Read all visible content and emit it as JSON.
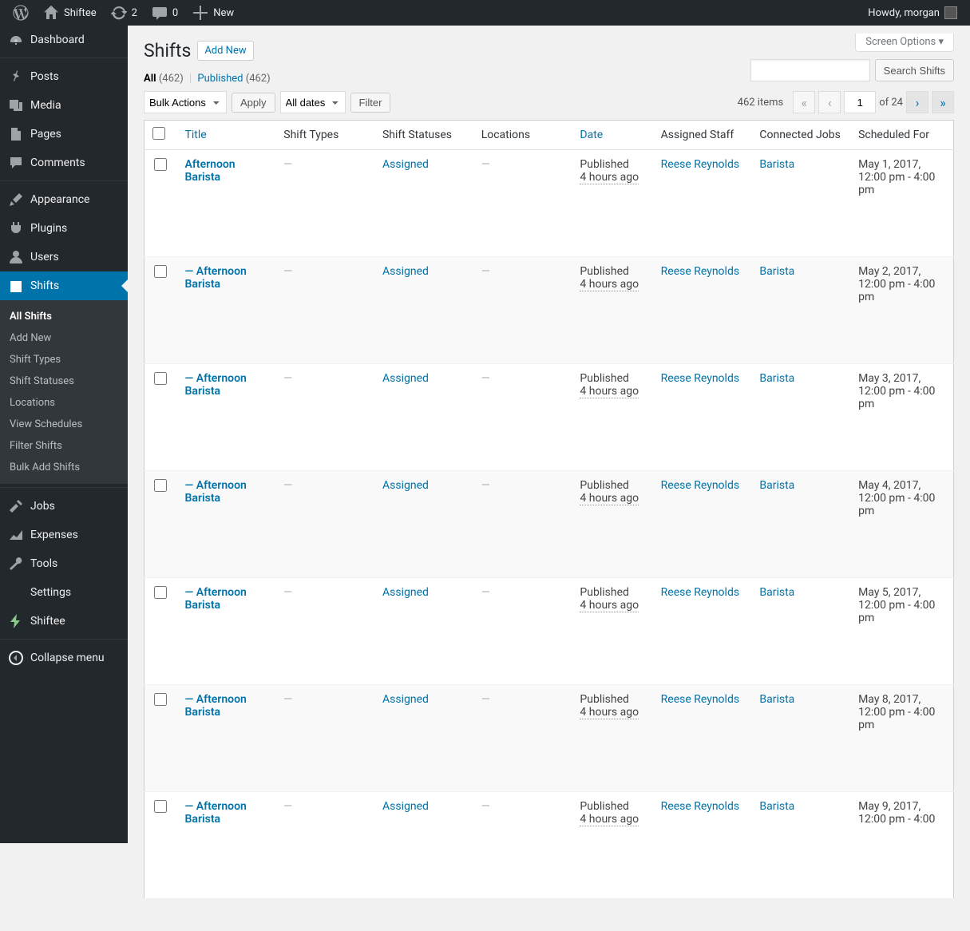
{
  "adminbar": {
    "site_name": "Shiftee",
    "updates_count": "2",
    "comments_count": "0",
    "new_label": "New",
    "greeting": "Howdy, morgan"
  },
  "sidebar": {
    "items": [
      {
        "label": "Dashboard",
        "icon": "dashboard"
      },
      {
        "label": "Posts",
        "icon": "pin"
      },
      {
        "label": "Media",
        "icon": "media"
      },
      {
        "label": "Pages",
        "icon": "page"
      },
      {
        "label": "Comments",
        "icon": "comment"
      },
      {
        "label": "Appearance",
        "icon": "brush"
      },
      {
        "label": "Plugins",
        "icon": "plugin"
      },
      {
        "label": "Users",
        "icon": "user"
      },
      {
        "label": "Shifts",
        "icon": "calendar",
        "current": true
      },
      {
        "label": "Jobs",
        "icon": "hammer"
      },
      {
        "label": "Expenses",
        "icon": "chart"
      },
      {
        "label": "Tools",
        "icon": "wrench"
      },
      {
        "label": "Settings",
        "icon": "settings"
      },
      {
        "label": "Shiftee",
        "icon": "bolt"
      },
      {
        "label": "Collapse menu",
        "icon": "collapse"
      }
    ],
    "submenu": [
      {
        "label": "All Shifts",
        "current": true
      },
      {
        "label": "Add New"
      },
      {
        "label": "Shift Types"
      },
      {
        "label": "Shift Statuses"
      },
      {
        "label": "Locations"
      },
      {
        "label": "View Schedules"
      },
      {
        "label": "Filter Shifts"
      },
      {
        "label": "Bulk Add Shifts"
      }
    ]
  },
  "page": {
    "title": "Shifts",
    "add_new": "Add New",
    "screen_options": "Screen Options",
    "filters": {
      "all_label": "All",
      "all_count": "(462)",
      "published_label": "Published",
      "published_count": "(462)"
    },
    "search_button": "Search Shifts",
    "bulk_actions": "Bulk Actions",
    "apply": "Apply",
    "all_dates": "All dates",
    "filter": "Filter",
    "pagination": {
      "items": "462 items",
      "current": "1",
      "of": "of 24"
    },
    "columns": {
      "title": "Title",
      "types": "Shift Types",
      "statuses": "Shift Statuses",
      "locations": "Locations",
      "date": "Date",
      "staff": "Assigned Staff",
      "jobs": "Connected Jobs",
      "scheduled": "Scheduled For"
    }
  },
  "rows": [
    {
      "title": "Afternoon Barista",
      "types": "—",
      "status": "Assigned",
      "locations": "—",
      "date_status": "Published",
      "date_rel": "4 hours ago",
      "staff": "Reese Reynolds",
      "job": "Barista",
      "scheduled": "May 1, 2017, 12:00 pm - 4:00 pm"
    },
    {
      "title": "— Afternoon Barista",
      "types": "—",
      "status": "Assigned",
      "locations": "—",
      "date_status": "Published",
      "date_rel": "4 hours ago",
      "staff": "Reese Reynolds",
      "job": "Barista",
      "scheduled": "May 2, 2017, 12:00 pm - 4:00 pm"
    },
    {
      "title": "— Afternoon Barista",
      "types": "—",
      "status": "Assigned",
      "locations": "—",
      "date_status": "Published",
      "date_rel": "4 hours ago",
      "staff": "Reese Reynolds",
      "job": "Barista",
      "scheduled": "May 3, 2017, 12:00 pm - 4:00 pm"
    },
    {
      "title": "— Afternoon Barista",
      "types": "—",
      "status": "Assigned",
      "locations": "—",
      "date_status": "Published",
      "date_rel": "4 hours ago",
      "staff": "Reese Reynolds",
      "job": "Barista",
      "scheduled": "May 4, 2017, 12:00 pm - 4:00 pm"
    },
    {
      "title": "— Afternoon Barista",
      "types": "—",
      "status": "Assigned",
      "locations": "—",
      "date_status": "Published",
      "date_rel": "4 hours ago",
      "staff": "Reese Reynolds",
      "job": "Barista",
      "scheduled": "May 5, 2017, 12:00 pm - 4:00 pm"
    },
    {
      "title": "— Afternoon Barista",
      "types": "—",
      "status": "Assigned",
      "locations": "—",
      "date_status": "Published",
      "date_rel": "4 hours ago",
      "staff": "Reese Reynolds",
      "job": "Barista",
      "scheduled": "May 8, 2017, 12:00 pm - 4:00 pm"
    },
    {
      "title": "— Afternoon Barista",
      "types": "—",
      "status": "Assigned",
      "locations": "—",
      "date_status": "Published",
      "date_rel": "4 hours ago",
      "staff": "Reese Reynolds",
      "job": "Barista",
      "scheduled": "May 9, 2017, 12:00 pm - 4:00"
    }
  ]
}
